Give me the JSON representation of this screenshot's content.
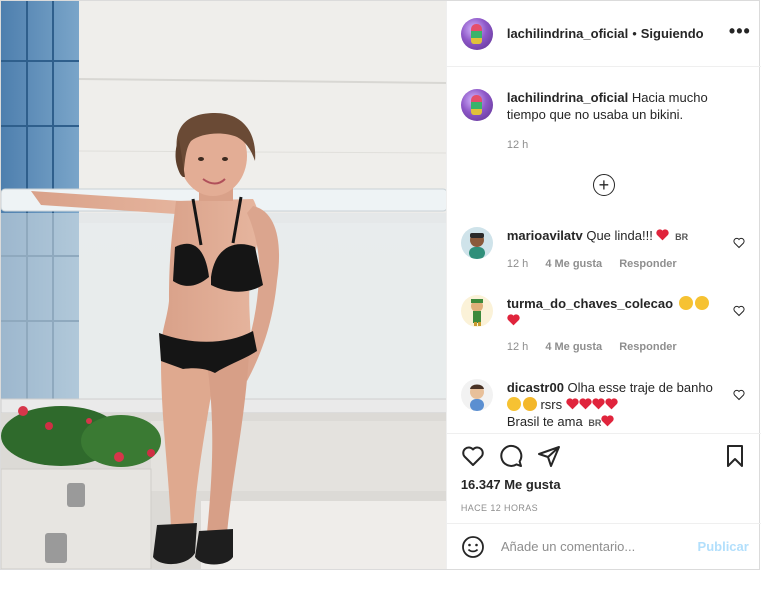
{
  "post": {
    "username": "lachilindrina_oficial",
    "separator": "•",
    "follow_status": "Siguiendo",
    "more_icon": "more-horizontal-icon"
  },
  "caption": {
    "username": "lachilindrina_oficial",
    "text": "Hacia mucho tiempo que no usaba un bikini.",
    "time": "12 h"
  },
  "comments": [
    {
      "username": "marioavilatv",
      "text": "Que linda!!!",
      "emojis": [
        "red-heart",
        "brazil-flag"
      ],
      "flag_text": "BR",
      "time": "12 h",
      "likes": "4 Me gusta",
      "reply": "Responder"
    },
    {
      "username": "turma_do_chaves_colecao",
      "text": "",
      "emojis": [
        "clapping-hands",
        "clapping-hands",
        "red-heart"
      ],
      "time": "12 h",
      "likes": "4 Me gusta",
      "reply": "Responder"
    },
    {
      "username": "dicastr00",
      "text": "Olha esse traje de banho",
      "text_mid": "rsrs",
      "text_end": "Brasil te ama",
      "flag_text": "BR",
      "emojis": [
        "smiling-face",
        "grinning-face",
        "red-heart",
        "red-heart",
        "red-heart",
        "red-heart",
        "brazil-flag",
        "heart-with-ribbon"
      ]
    }
  ],
  "actions": {
    "like_icon": "heart-outline-icon",
    "comment_icon": "comment-bubble-icon",
    "share_icon": "paper-plane-icon",
    "save_icon": "bookmark-icon"
  },
  "likes_text": "16.347 Me gusta",
  "timestamp": "HACE 12 HORAS",
  "add_comment": {
    "placeholder": "Añade un comentario...",
    "publish_label": "Publicar",
    "emoji_icon": "smiley-icon"
  },
  "colors": {
    "text": "#262626",
    "muted": "#8e8e8e",
    "border": "#dbdbdb",
    "publish_disabled": "#b2dffc",
    "heart_red": "#ed4956"
  }
}
